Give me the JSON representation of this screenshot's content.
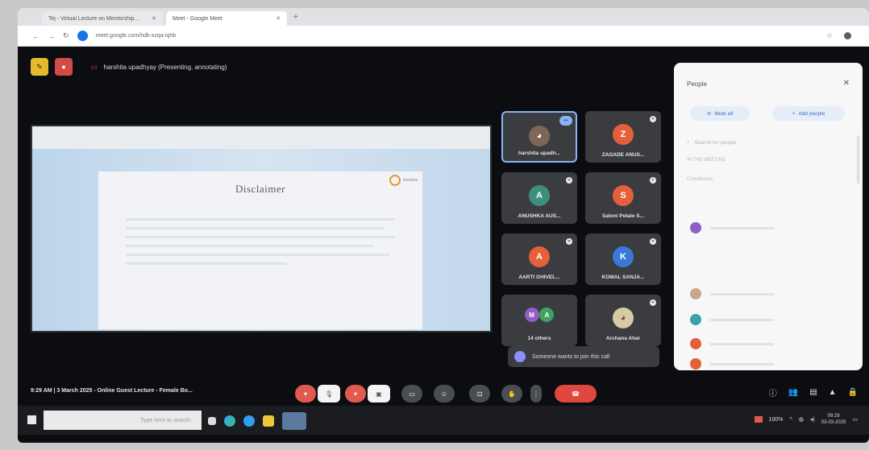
{
  "browser": {
    "tabs": [
      {
        "label": "Tej - Virtual Lecture on Mentorship..."
      },
      {
        "label": "Meet - Google Meet"
      }
    ],
    "url": "meet.google.com/hdk-xzqa-iqhb"
  },
  "meet": {
    "presenter_status": "harshita upadhyay (Presenting, annotating)",
    "slide": {
      "title": "Disclaimer",
      "logo_text": "mentora"
    },
    "tiles": [
      {
        "name": "harshita upadh...",
        "initial": "",
        "color": "#7d6658"
      },
      {
        "name": "ZAGADE ANUS...",
        "initial": "Z",
        "color": "#e4603a"
      },
      {
        "name": "ANUSHKA AUS...",
        "initial": "A",
        "color": "#3f8f7e"
      },
      {
        "name": "Saloni Petale S...",
        "initial": "S",
        "color": "#e4603a"
      },
      {
        "name": "AARTI GHIVEL...",
        "initial": "A",
        "color": "#e4603a"
      },
      {
        "name": "KOMAL SANJA...",
        "initial": "K",
        "color": "#3c78d8"
      },
      {
        "name": "14 others",
        "initial": "M",
        "color": "#8f5fc4"
      },
      {
        "name": "Archana Ahar",
        "initial": "",
        "color": "#d8c9a7"
      }
    ],
    "notification": "Someone wants to join this call",
    "meeting_info": "9:29 AM  |  3 March 2025 - Online Guest Lecture - Female Bo...",
    "end_call_icon": "phone-hangup-icon"
  },
  "people_panel": {
    "title": "People",
    "add_people": "Add people",
    "mute_all": "Mute all",
    "search_placeholder": "Search for people",
    "section_label": "IN THE MEETING",
    "contributors": "Contributors"
  },
  "taskbar": {
    "search_placeholder": "Type here to search",
    "time": "09:29",
    "date": "03-03-2025",
    "battery": "100%"
  }
}
